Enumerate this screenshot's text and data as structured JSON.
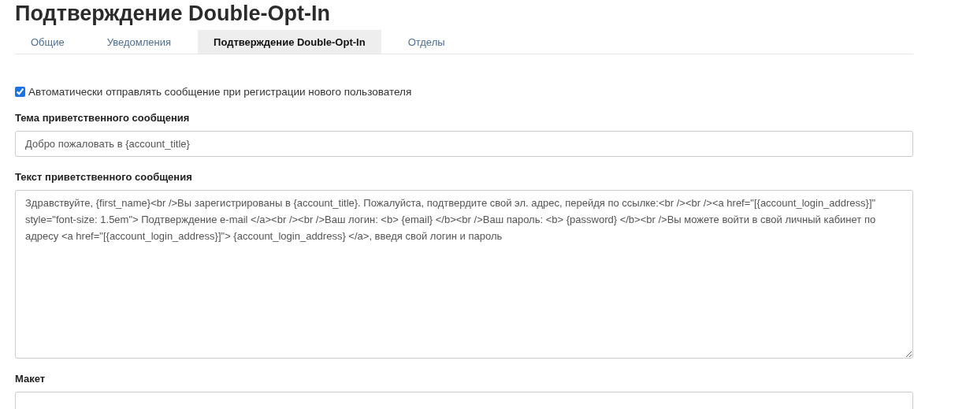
{
  "page": {
    "title": "Подтверждение Double-Opt-In"
  },
  "tabs": [
    {
      "label": "Общие",
      "selected": false
    },
    {
      "label": "Уведомления",
      "selected": false
    },
    {
      "label": "Подтверждение Double-Opt-In",
      "selected": true
    },
    {
      "label": "Отделы",
      "selected": false
    }
  ],
  "auto_send": {
    "label": "Автоматически отправлять сообщение при регистрации нового пользователя",
    "checked": true
  },
  "subject": {
    "label": "Тема приветственного сообщения",
    "value": "Добро пожаловать в {account_title}"
  },
  "body": {
    "label": "Текст приветственного сообщения",
    "value": "Здравствуйте, {first_name}<br />Вы зарегистрированы в {account_title}. Пожалуйста, подтвердите свой эл. адрес, перейдя по ссылке:<br /><br /><a href=\"[{account_login_address}]\" style=\"font-size: 1.5em\"> Подтверждение e-mail </a><br /><br />Ваш логин: <b> {email} </b><br />Ваш пароль: <b> {password} </b><br />Вы можете войти в свой личный кабинет по адресу <a href=\"[{account_login_address}]\"> {account_login_address} </a>, введя свой логин и пароль"
  },
  "layout": {
    "label": "Макет"
  }
}
